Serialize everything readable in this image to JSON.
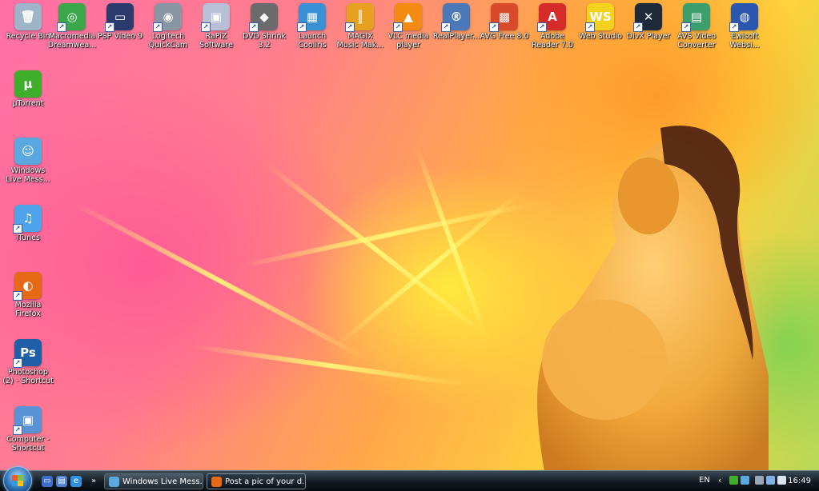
{
  "desktop": {
    "icons": [
      {
        "id": "recycle-bin",
        "label": "Recycle Bin",
        "icon": "recycle-bin-icon",
        "color": "#9fb4c8",
        "glyph": "🗑",
        "shortcut": false
      },
      {
        "id": "macromedia-dreamweaver",
        "label": "Macromedia\nDreamwea...",
        "icon": "dreamweaver-icon",
        "color": "#3aa84a",
        "glyph": "◎",
        "shortcut": true
      },
      {
        "id": "psp-video-9",
        "label": "PSP Video 9",
        "icon": "psp-icon",
        "color": "#2b3b6e",
        "glyph": "▭",
        "shortcut": true
      },
      {
        "id": "logitech-quickcam",
        "label": "Logitech\nQuickCam",
        "icon": "webcam-icon",
        "color": "#8a96a3",
        "glyph": "◉",
        "shortcut": true
      },
      {
        "id": "rapiz-software",
        "label": "RaPiZ\nSoftware",
        "icon": "rapiz-icon",
        "color": "#b8c0d8",
        "glyph": "▣",
        "shortcut": true
      },
      {
        "id": "dvd-shrink",
        "label": "DVD Shrink\n3.2",
        "icon": "dvd-shrink-icon",
        "color": "#6b6b6b",
        "glyph": "◆",
        "shortcut": true
      },
      {
        "id": "launch-cooliris",
        "label": "Launch\nCooliris",
        "icon": "cooliris-icon",
        "color": "#3a90d4",
        "glyph": "▦",
        "shortcut": true
      },
      {
        "id": "magix-music-maker",
        "label": "MAGIX\nMusic Mak...",
        "icon": "magix-icon",
        "color": "#e8a020",
        "glyph": "║",
        "shortcut": true
      },
      {
        "id": "vlc-media-player",
        "label": "VLC media\nplayer",
        "icon": "vlc-cone-icon",
        "color": "#f38a12",
        "glyph": "▲",
        "shortcut": true
      },
      {
        "id": "realplayer",
        "label": "RealPlayer...",
        "icon": "realplayer-icon",
        "color": "#4a78b8",
        "glyph": "®",
        "shortcut": true
      },
      {
        "id": "avg-free",
        "label": "AVG Free 8.0",
        "icon": "avg-icon",
        "color": "#d84a2a",
        "glyph": "▩",
        "shortcut": true
      },
      {
        "id": "adobe-reader",
        "label": "Adobe\nReader 7.0",
        "icon": "adobe-reader-icon",
        "color": "#d72b2b",
        "glyph": "A",
        "shortcut": true
      },
      {
        "id": "web-studio",
        "label": "Web Studio",
        "icon": "web-studio-icon",
        "color": "#f2d21c",
        "glyph": "WS",
        "shortcut": true
      },
      {
        "id": "divx-player",
        "label": "DivX Player",
        "icon": "divx-icon",
        "color": "#1e2a3a",
        "glyph": "✕",
        "shortcut": true
      },
      {
        "id": "avs-video-converter",
        "label": "AVS Video\nConverter",
        "icon": "avs-icon",
        "color": "#3b9e6b",
        "glyph": "▤",
        "shortcut": true
      },
      {
        "id": "ewisoft-website",
        "label": "Ewisoft\nWebsi...",
        "icon": "ewisoft-globe-icon",
        "color": "#2a56b0",
        "glyph": "◍",
        "shortcut": true
      },
      {
        "id": "utorrent",
        "label": "µTorrent",
        "icon": "utorrent-icon",
        "color": "#3fae2a",
        "glyph": "µ",
        "shortcut": false
      },
      {
        "id": "windows-live-messenger",
        "label": "Windows\nLive Mess...",
        "icon": "messenger-icon",
        "color": "#5aa8e0",
        "glyph": "☺",
        "shortcut": false
      },
      {
        "id": "itunes",
        "label": "iTunes",
        "icon": "itunes-icon",
        "color": "#4fa3e8",
        "glyph": "♫",
        "shortcut": true
      },
      {
        "id": "mozilla-firefox",
        "label": "Mozilla\nFirefox",
        "icon": "firefox-icon",
        "color": "#e66a16",
        "glyph": "◐",
        "shortcut": true
      },
      {
        "id": "photoshop-shortcut",
        "label": "Photoshop\n(2) - Shortcut",
        "icon": "photoshop-icon",
        "color": "#1f5fa8",
        "glyph": "Ps",
        "shortcut": true
      },
      {
        "id": "computer-shortcut",
        "label": "Computer -\nShortcut",
        "icon": "computer-icon",
        "color": "#5a92d6",
        "glyph": "▣",
        "shortcut": true
      }
    ]
  },
  "taskbar": {
    "quick_launch": [
      {
        "name": "show-desktop-icon",
        "color": "#3a6ec8",
        "glyph": "▭"
      },
      {
        "name": "switch-windows-icon",
        "color": "#4a7fd0",
        "glyph": "▤"
      },
      {
        "name": "internet-explorer-icon",
        "color": "#2f8fe0",
        "glyph": "e"
      },
      {
        "name": "overflow-chevron-icon",
        "color": "transparent",
        "glyph": "»"
      }
    ],
    "buttons": [
      {
        "label": "Windows Live Mess...",
        "icon": "messenger-icon",
        "color": "#5aa8e0",
        "active": false
      },
      {
        "label": "Post a pic of your d...",
        "icon": "firefox-icon",
        "color": "#e66a16",
        "active": true
      }
    ],
    "tray": {
      "language": "EN",
      "time": "16:49",
      "icons": [
        {
          "name": "tray-chevron-icon",
          "color": "transparent"
        },
        {
          "name": "tray-utorrent-icon",
          "color": "#3fae2a"
        },
        {
          "name": "tray-messenger-icon",
          "color": "#5aa8e0"
        },
        {
          "name": "tray-safely-remove-icon",
          "color": "#9aa7b4"
        },
        {
          "name": "tray-network-icon",
          "color": "#7fb0e6"
        },
        {
          "name": "tray-volume-icon",
          "color": "#d9e4ee"
        }
      ]
    }
  }
}
